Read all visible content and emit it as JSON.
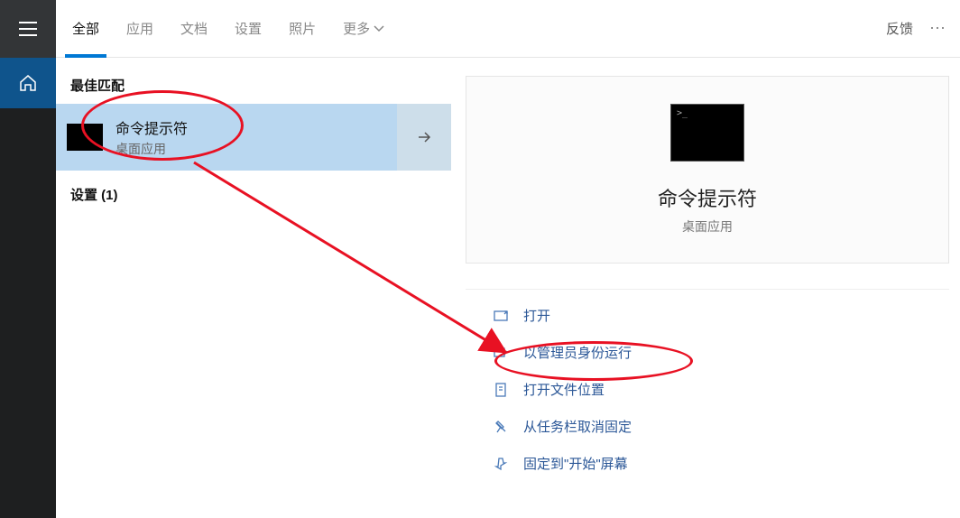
{
  "topbar": {
    "tabs": [
      "全部",
      "应用",
      "文档",
      "设置",
      "照片",
      "更多"
    ],
    "active_index": 0,
    "feedback": "反馈"
  },
  "results": {
    "best_match_header": "最佳匹配",
    "best_match": {
      "title": "命令提示符",
      "subtitle": "桌面应用"
    },
    "settings_header": "设置 (1)"
  },
  "preview": {
    "title": "命令提示符",
    "subtitle": "桌面应用",
    "actions": [
      {
        "icon": "open",
        "label": "打开"
      },
      {
        "icon": "admin",
        "label": "以管理员身份运行"
      },
      {
        "icon": "folder",
        "label": "打开文件位置"
      },
      {
        "icon": "unpin",
        "label": "从任务栏取消固定"
      },
      {
        "icon": "pin-start",
        "label": "固定到\"开始\"屏幕"
      }
    ]
  }
}
